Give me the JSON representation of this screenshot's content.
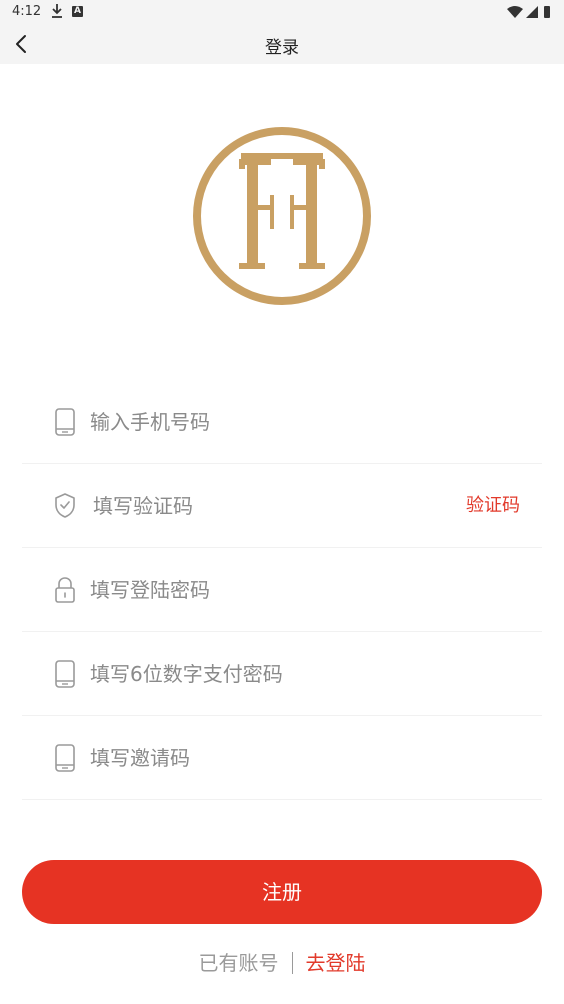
{
  "status_bar": {
    "time": "4:12"
  },
  "nav": {
    "title": "登录",
    "back_icon": "back-arrow-icon"
  },
  "logo": {
    "monogram": "FF",
    "color": "#c9a063"
  },
  "form": {
    "phone_placeholder": "输入手机号码",
    "code_placeholder": "填写验证码",
    "code_button": "验证码",
    "password_placeholder": "填写登陆密码",
    "pay_password_placeholder": "填写6位数字支付密码",
    "invite_placeholder": "填写邀请码"
  },
  "submit_label": "注册",
  "footer": {
    "have_account": "已有账号",
    "go_login": "去登陆"
  },
  "colors": {
    "accent": "#e63323",
    "link": "#e23a2b",
    "placeholder": "#8a8a8a"
  }
}
